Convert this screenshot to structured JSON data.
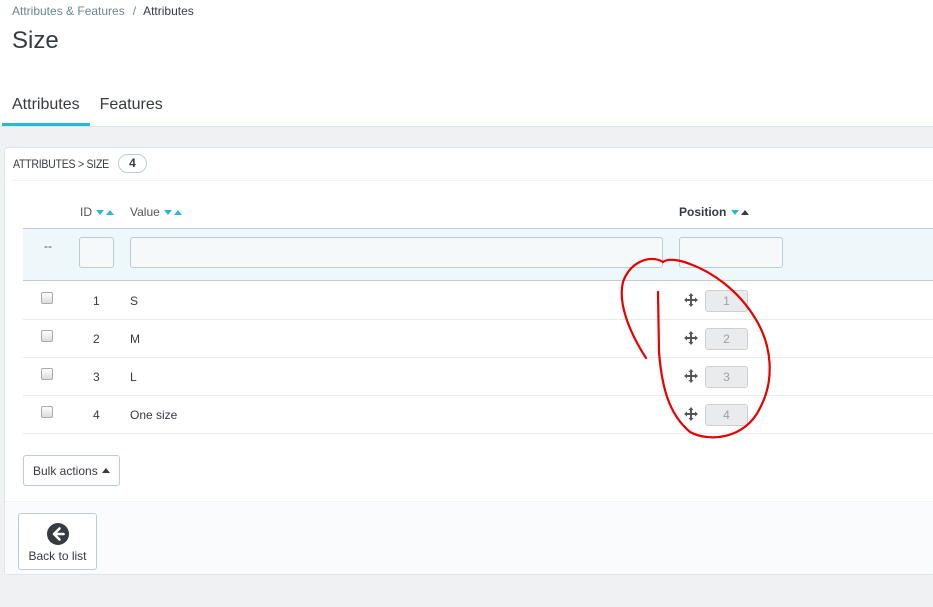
{
  "breadcrumb": {
    "parent": "Attributes & Features",
    "separator": "/",
    "current": "Attributes"
  },
  "page_title": "Size",
  "tabs": [
    {
      "label": "Attributes",
      "active": true
    },
    {
      "label": "Features",
      "active": false
    }
  ],
  "panel": {
    "heading": "ATTRIBUTES > SIZE",
    "count": "4"
  },
  "columns": {
    "id": "ID",
    "value": "Value",
    "position": "Position"
  },
  "filter": {
    "dash": "--",
    "id_value": "",
    "value_value": "",
    "position_value": ""
  },
  "rows": [
    {
      "id": "1",
      "value": "S",
      "position": "1"
    },
    {
      "id": "2",
      "value": "M",
      "position": "2"
    },
    {
      "id": "3",
      "value": "L",
      "position": "3"
    },
    {
      "id": "4",
      "value": "One size",
      "position": "4"
    }
  ],
  "bulk_actions_label": "Bulk actions",
  "back_to_list_label": "Back to list",
  "colors": {
    "accent": "#25b9d7",
    "annotation": "#e60000",
    "text": "#363a41"
  },
  "icons": {
    "move": "move-arrows-icon",
    "back": "arrow-left-circle-icon"
  }
}
